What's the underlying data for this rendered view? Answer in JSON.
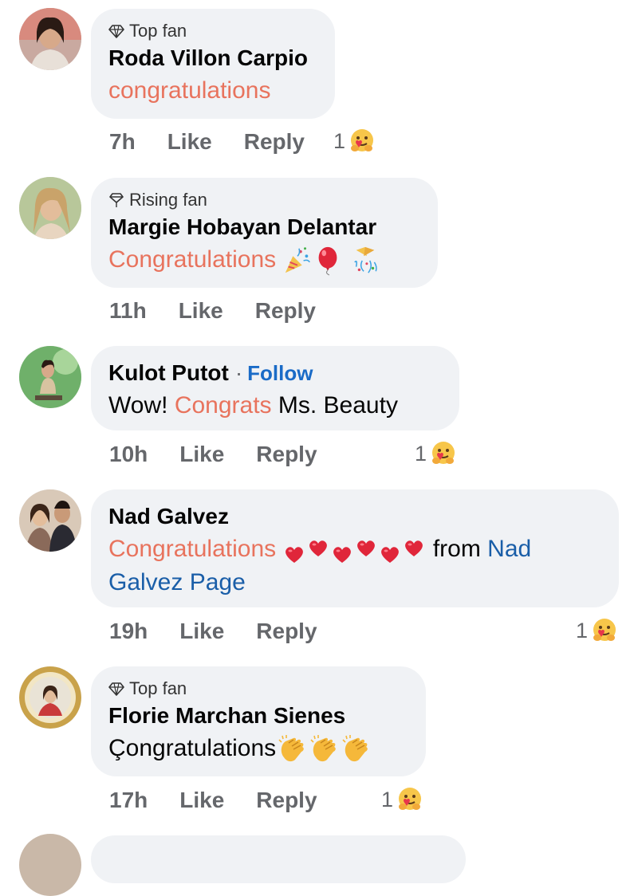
{
  "comments": [
    {
      "badge": "Top fan",
      "name": "Roda Villon Carpio",
      "text_hl": "congratulations",
      "time": "7h",
      "like": "Like",
      "reply": "Reply",
      "reactions": "1",
      "reaction_icon": "care-emoji"
    },
    {
      "badge": "Rising fan",
      "name": "Margie Hobayan Delantar",
      "text_hl": "Congratulations",
      "emojis": [
        "party-popper-icon",
        "balloon-icon",
        "confetti-icon"
      ],
      "time": "11h",
      "like": "Like",
      "reply": "Reply"
    },
    {
      "name": "Kulot Putot",
      "separator": "·",
      "follow": "Follow",
      "text_pre": "Wow!",
      "text_hl": "Congrats",
      "text_post": "Ms. Beauty",
      "time": "10h",
      "like": "Like",
      "reply": "Reply",
      "reactions": "1",
      "reaction_icon": "care-emoji"
    },
    {
      "name": "Nad Galvez",
      "text_hl": "Congratulations",
      "emojis": [
        "heart-icon",
        "heart-icon",
        "heart-icon"
      ],
      "text_post": "from",
      "text_link": "Nad Galvez Page",
      "time": "19h",
      "like": "Like",
      "reply": "Reply",
      "reactions": "1",
      "reaction_icon": "care-emoji"
    },
    {
      "badge": "Top fan",
      "name": "Florie Marchan Sienes",
      "text": "Çongratulations",
      "emojis": [
        "clapping-hands-icon",
        "clapping-hands-icon",
        "clapping-hands-icon"
      ],
      "time": "17h",
      "like": "Like",
      "reply": "Reply",
      "reactions": "1",
      "reaction_icon": "care-emoji"
    }
  ],
  "colors": {
    "bubble": "#f0f2f5",
    "highlight": "#e8735d",
    "link": "#1a5ea8",
    "follow": "#1a6bc7",
    "meta": "#65676b"
  }
}
